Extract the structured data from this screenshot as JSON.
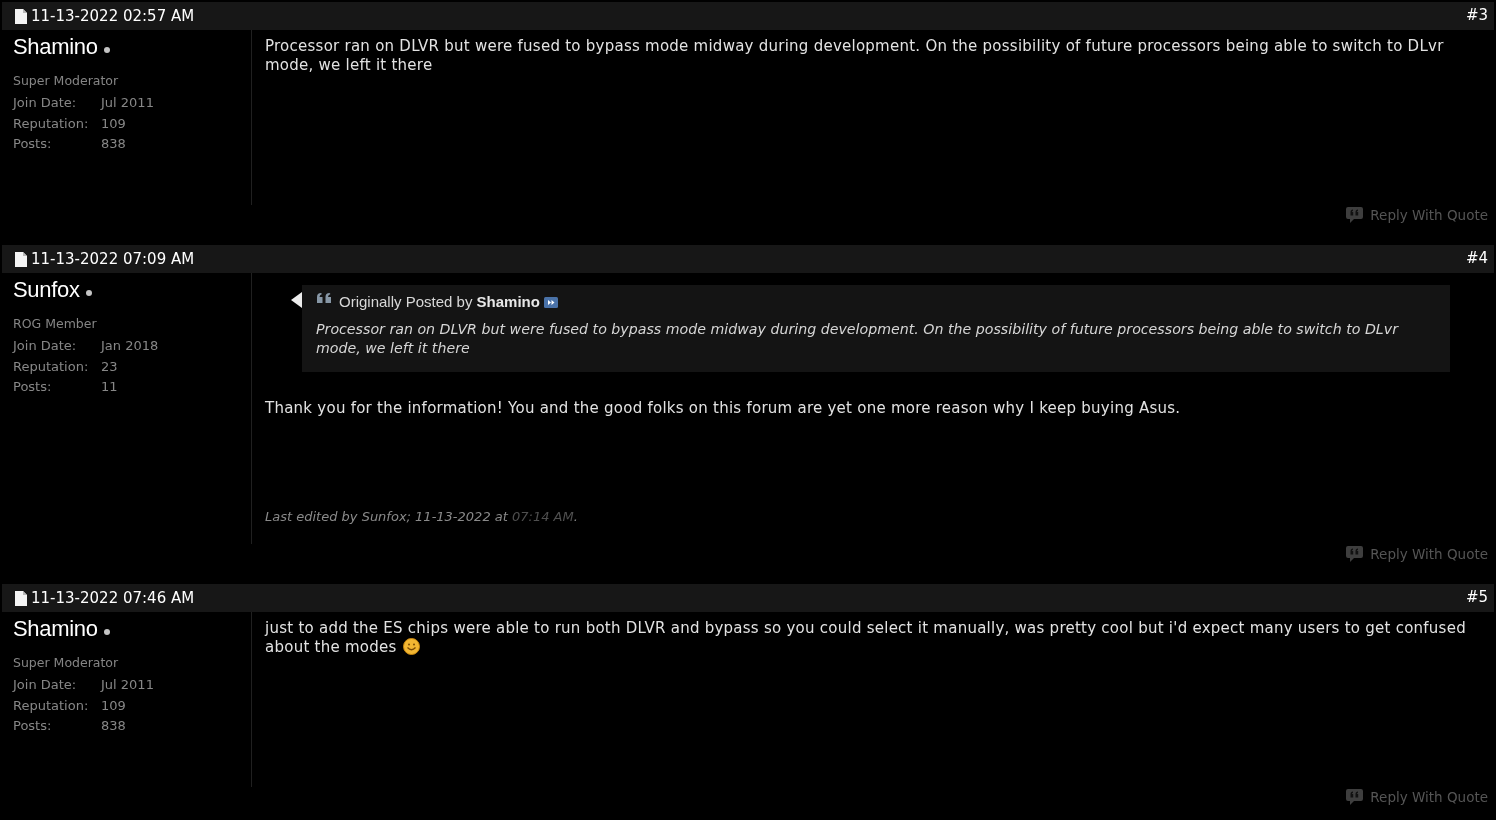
{
  "posts": [
    {
      "date": "11-13-2022 02:57 AM",
      "number": "#3",
      "user": {
        "name": "Shamino",
        "online": false,
        "title": "Super Moderator",
        "stats": [
          {
            "label": "Join Date:",
            "value": "Jul 2011"
          },
          {
            "label": "Reputation:",
            "value": "109"
          },
          {
            "label": "Posts:",
            "value": "838"
          }
        ]
      },
      "message": [
        {
          "kind": "text",
          "text": "Processor ran on DLVR but were fused to bypass mode midway during development. On the possibility of future processors being able to switch to DLvr mode, we left it there"
        }
      ],
      "reply_button": "Reply With Quote"
    },
    {
      "date": "11-13-2022 07:09 AM",
      "number": "#4",
      "user": {
        "name": "Sunfox",
        "online": false,
        "title": "ROG Member",
        "stats": [
          {
            "label": "Join Date:",
            "value": "Jan 2018"
          },
          {
            "label": "Reputation:",
            "value": "23"
          },
          {
            "label": "Posts:",
            "value": "11"
          }
        ]
      },
      "quote": {
        "attribution": "Originally Posted by **Shamino**",
        "text": "Processor ran on DLVR but were fused to bypass mode midway during development. On the possibility of future processors being able to switch to DLvr mode, we left it there"
      },
      "message": [
        {
          "kind": "text",
          "text": "Thank you for the information! You and the good folks on this forum are yet one more reason why I keep buying Asus."
        }
      ],
      "edit_note": {
        "text": "Last edited by Sunfox; 11-13-2022 at",
        "time": "07:14 AM",
        "end": "."
      },
      "reply_button": "Reply With Quote"
    },
    {
      "date": "11-13-2022 07:46 AM",
      "number": "#5",
      "user": {
        "name": "Shamino",
        "online": false,
        "title": "Super Moderator",
        "stats": [
          {
            "label": "Join Date:",
            "value": "Jul 2011"
          },
          {
            "label": "Reputation:",
            "value": "109"
          },
          {
            "label": "Posts:",
            "value": "838"
          }
        ]
      },
      "message": [
        {
          "kind": "text",
          "text": "just to add the ES chips were able to run both DLVR and bypass so you could select it manually, was pretty cool but i'd expect many users to get confused about the modes"
        },
        {
          "kind": "smiley"
        }
      ],
      "reply_button": "Reply With Quote"
    }
  ]
}
